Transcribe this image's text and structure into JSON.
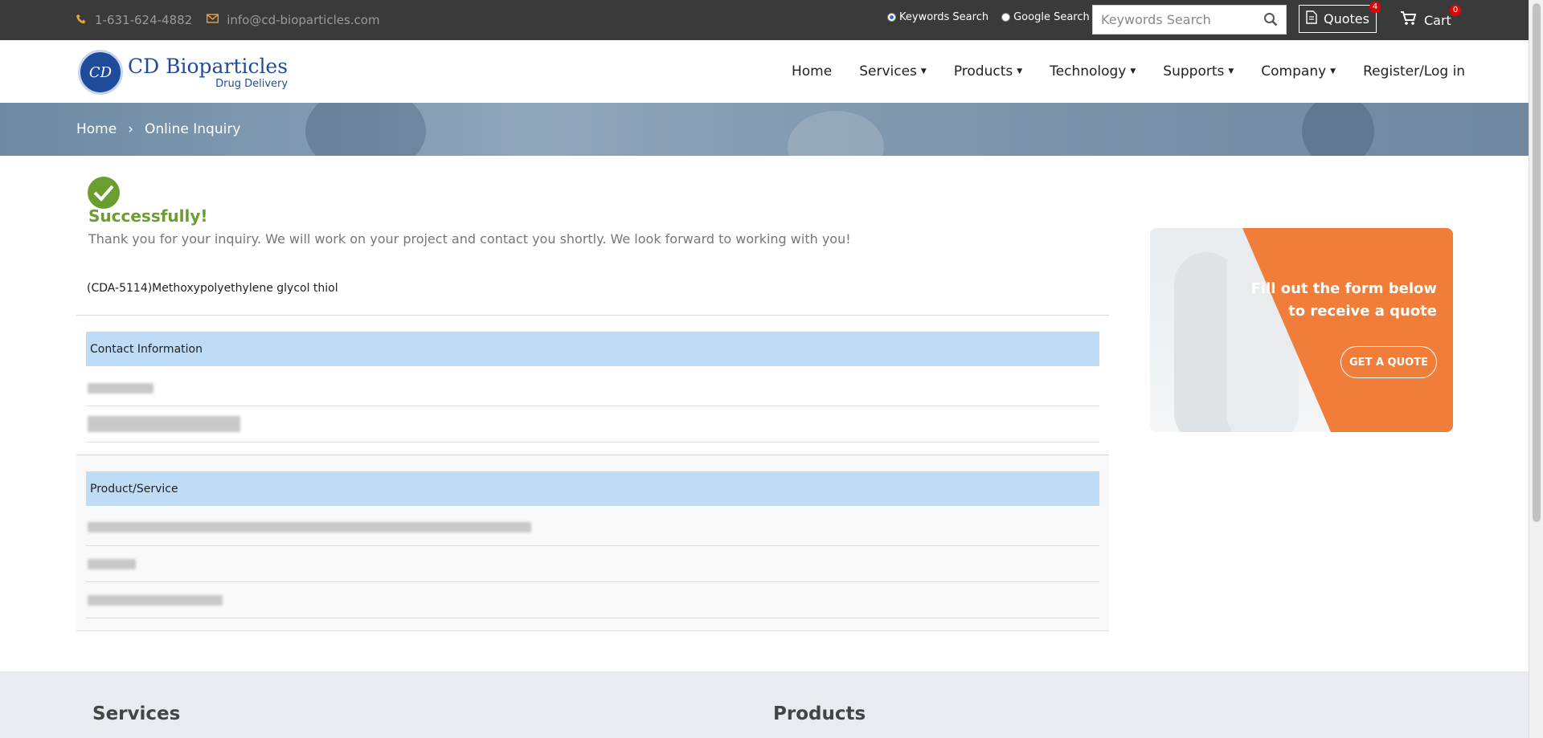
{
  "topbar": {
    "phone": "1-631-624-4882",
    "email": "info@cd-bioparticles.com",
    "search_options": [
      {
        "label": "Keywords Search",
        "selected": true
      },
      {
        "label": "Google Search",
        "selected": false
      }
    ],
    "search_placeholder": "Keywords Search",
    "quotes_label": "Quotes",
    "quotes_count": "4",
    "cart_label": "Cart",
    "cart_count": "0"
  },
  "logo": {
    "mark": "CD",
    "name": "CD Bioparticles",
    "tagline": "Drug Delivery"
  },
  "nav": {
    "items": [
      {
        "label": "Home",
        "dropdown": false
      },
      {
        "label": "Services",
        "dropdown": true
      },
      {
        "label": "Products",
        "dropdown": true
      },
      {
        "label": "Technology",
        "dropdown": true
      },
      {
        "label": "Supports",
        "dropdown": true
      },
      {
        "label": "Company",
        "dropdown": true
      },
      {
        "label": "Register/Log in",
        "dropdown": false
      }
    ]
  },
  "breadcrumb": {
    "home": "Home",
    "separator": "›",
    "current": "Online Inquiry"
  },
  "main": {
    "success_title": "Successfully!",
    "success_message": "Thank you for your inquiry. We will work on your project and contact you shortly. We look forward to working with you!",
    "product_name": "(CDA-5114)Methoxypolyethylene glycol thiol",
    "contact_header": "Contact Information",
    "product_header": "Product/Service"
  },
  "ad": {
    "headline_line1": "Fill out the form below",
    "headline_line2": "to receive a quote",
    "cta": "GET A QUOTE"
  },
  "footer": {
    "services_title": "Services",
    "products_title": "Products"
  },
  "colors": {
    "topbar_bg": "#3a3a3a",
    "accent_orange": "#e8a23a",
    "success_green": "#6a9e2f",
    "section_blue": "#bfdcf7",
    "brand_blue": "#1f4c9a",
    "ad_orange": "#f07d3a"
  }
}
